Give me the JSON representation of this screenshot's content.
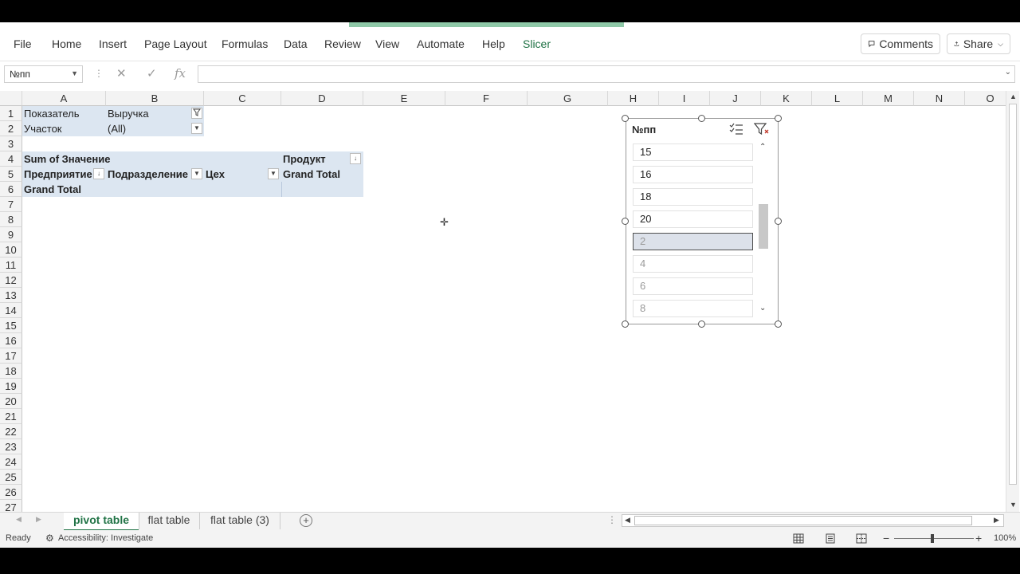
{
  "ribbon": {
    "menu": [
      "File",
      "Home",
      "Insert",
      "Page Layout",
      "Formulas",
      "Data",
      "Review",
      "View",
      "Automate",
      "Help",
      "Slicer"
    ],
    "comments_label": "Comments",
    "share_label": "Share"
  },
  "formula_bar": {
    "name_box": "№пп",
    "fx_label": "fx",
    "formula": ""
  },
  "columns": [
    "A",
    "B",
    "C",
    "D",
    "E",
    "F",
    "G",
    "H",
    "I",
    "J",
    "K",
    "L",
    "M",
    "N",
    "O"
  ],
  "rows": [
    "1",
    "2",
    "3",
    "4",
    "5",
    "6",
    "7",
    "8",
    "9",
    "10",
    "11",
    "12",
    "13",
    "14",
    "15",
    "16",
    "17",
    "18",
    "19",
    "20",
    "21",
    "22",
    "23",
    "24",
    "25",
    "26",
    "27"
  ],
  "pivot": {
    "filter1_label": "Показатель",
    "filter1_value": "Выручка",
    "filter2_label": "Участок",
    "filter2_value": "(All)",
    "values_header": "Sum of Значение",
    "col_field": "Продукт",
    "row_field1": "Предприятие",
    "row_field2": "Подразделение",
    "row_field3": "Цех",
    "grand_total_col": "Grand Total",
    "grand_total_row": "Grand Total"
  },
  "slicer": {
    "title": "№пп",
    "items": [
      {
        "label": "15",
        "state": "available"
      },
      {
        "label": "16",
        "state": "available"
      },
      {
        "label": "18",
        "state": "available"
      },
      {
        "label": "20",
        "state": "available"
      },
      {
        "label": "2",
        "state": "selected"
      },
      {
        "label": "4",
        "state": "nodata"
      },
      {
        "label": "6",
        "state": "nodata"
      },
      {
        "label": "8",
        "state": "nodata"
      }
    ]
  },
  "tabs": [
    {
      "label": "pivot table",
      "active": true
    },
    {
      "label": "flat table",
      "active": false
    },
    {
      "label": "flat table (3)",
      "active": false
    }
  ],
  "status": {
    "ready": "Ready",
    "accessibility": "Accessibility: Investigate",
    "zoom": "100%"
  },
  "colors": {
    "accent": "#217346",
    "pivot_fill": "#dce6f1"
  }
}
